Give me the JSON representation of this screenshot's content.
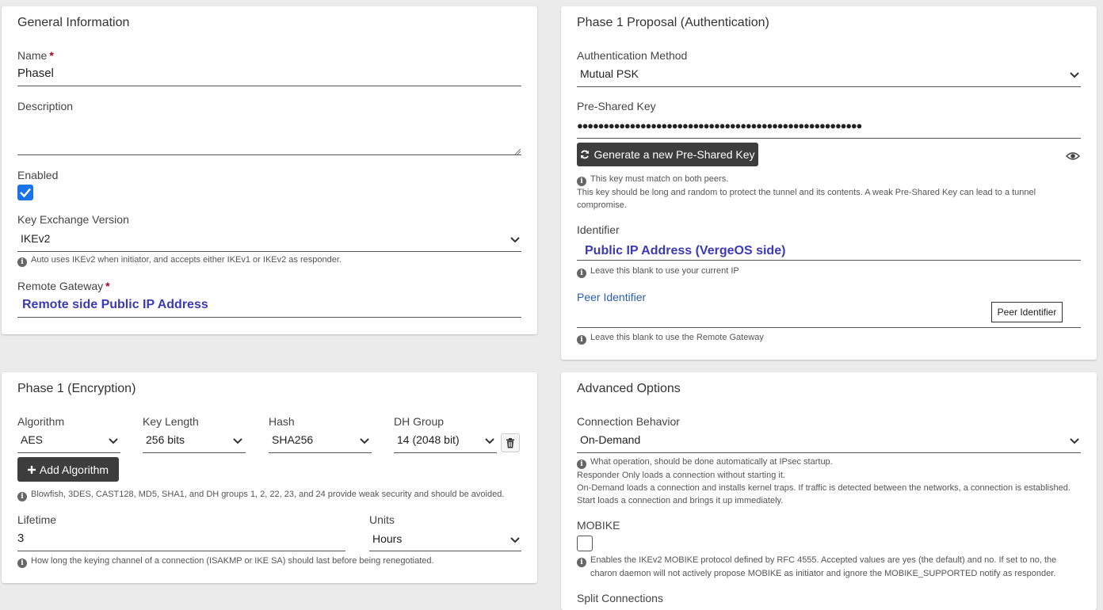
{
  "general": {
    "title": "General Information",
    "name_label": "Name",
    "name_value": "Phasel",
    "description_label": "Description",
    "description_value": "",
    "enabled_label": "Enabled",
    "enabled_checked": true,
    "kev_label": "Key Exchange Version",
    "kev_value": "IKEv2",
    "kev_help": "Auto uses IKEv2 when initiator, and accepts either IKEv1 or IKEv2 as responder.",
    "remote_gateway_label": "Remote Gateway",
    "remote_gateway_value": "Remote side Public IP Address"
  },
  "phase1_auth": {
    "title": "Phase 1 Proposal (Authentication)",
    "auth_method_label": "Authentication Method",
    "auth_method_value": "Mutual PSK",
    "psk_label": "Pre-Shared Key",
    "psk_masked": "●●●●●●●●●●●●●●●●●●●●●●●●●●●●●●●●●●●●●●●●●●●●●●●●●●●●●●",
    "generate_button": "Generate a new Pre-Shared Key",
    "psk_help": [
      "This key must match on both peers.",
      "This key should be long and random to protect the tunnel and its contents. A weak Pre-Shared Key can lead to a tunnel",
      "compromise."
    ],
    "identifier_label": "Identifier",
    "identifier_value": "Public IP Address (VergeOS side)",
    "identifier_help": "Leave this blank to use your current IP",
    "peer_identifier_label": "Peer Identifier",
    "peer_identifier_tooltip": "Peer Identifier",
    "peer_identifier_help": "Leave this blank to use the Remote Gateway"
  },
  "phase1_enc": {
    "title": "Phase 1 (Encryption)",
    "algorithm_label": "Algorithm",
    "algorithm_value": "AES",
    "key_length_label": "Key Length",
    "key_length_value": "256 bits",
    "hash_label": "Hash",
    "hash_value": "SHA256",
    "dh_label": "DH Group",
    "dh_value": "14 (2048 bit)",
    "add_algorithm_button": "Add Algorithm",
    "weak_help": "Blowfish, 3DES, CAST128, MD5, SHA1, and DH groups 1, 2, 22, 23, and 24 provide weak security and should be avoided.",
    "lifetime_label": "Lifetime",
    "lifetime_value": "3",
    "units_label": "Units",
    "units_value": "Hours",
    "lifetime_help": "How long the keying channel of a connection (ISAKMP or IKE SA) should last before being renegotiated."
  },
  "advanced": {
    "title": "Advanced Options",
    "conn_behavior_label": "Connection Behavior",
    "conn_behavior_value": "On-Demand",
    "conn_help": [
      "What operation, should be done automatically at IPsec startup.",
      "Responder Only loads a connection without starting it.",
      "On-Demand loads a connection and installs kernel traps. If traffic is detected between the networks, a connection is established.",
      "Start loads a connection and brings it up immediately."
    ],
    "mobike_label": "MOBIKE",
    "mobike_checked": false,
    "mobike_help": [
      "Enables the IKEv2 MOBIKE protocol defined by RFC 4555. Accepted values are yes (the default) and no. If set to no, the",
      "charon daemon will not actively propose MOBIKE as initiator and ignore the MOBIKE_SUPPORTED notify as responder."
    ],
    "split_label": "Split Connections"
  }
}
